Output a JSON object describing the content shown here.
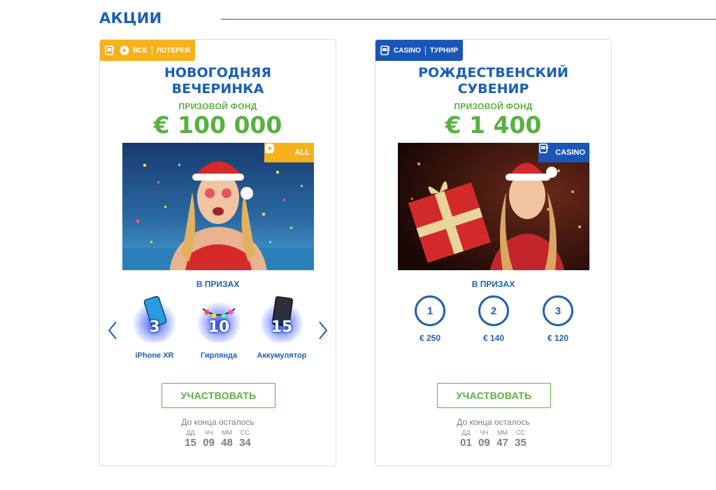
{
  "section": {
    "title": "АКЦИИ"
  },
  "promos": [
    {
      "tag": {
        "left": "ВСЕ",
        "right": "ЛОТЕРЕЯ"
      },
      "title": "НОВОГОДНЯЯ\nВЕЧЕРИНКА",
      "fund_label": "ПРИЗОВОЙ ФОНД",
      "fund_amount": "€ 100 000",
      "badge": "ALL",
      "prizes_label": "В ПРИЗАХ",
      "prizes": [
        {
          "qty": "3",
          "name": "iPhone XR",
          "icon": "phone-icon"
        },
        {
          "qty": "10",
          "name": "Гирлянда",
          "icon": "garland-icon"
        },
        {
          "qty": "15",
          "name": "Аккумулятор",
          "icon": "power-bank-icon"
        }
      ],
      "button": "УЧАСТВОВАТЬ",
      "remaining": "До конца осталось",
      "timer": {
        "labels": [
          "ДД",
          "ЧЧ",
          "ММ",
          "СС"
        ],
        "values": [
          "15",
          "09",
          "48",
          "34"
        ]
      }
    },
    {
      "tag": {
        "left": "CASINO",
        "right": "ТУРНИР"
      },
      "title": "РОЖДЕСТВЕНСКИЙ\nСУВЕНИР",
      "fund_label": "ПРИЗОВОЙ ФОНД",
      "fund_amount": "€ 1 400",
      "badge": "CASINO",
      "prizes_label": "В ПРИЗАХ",
      "places": [
        {
          "place": "1",
          "amount": "€ 250"
        },
        {
          "place": "2",
          "amount": "€ 140"
        },
        {
          "place": "3",
          "amount": "€ 120"
        }
      ],
      "button": "УЧАСТВОВАТЬ",
      "remaining": "До конца осталось",
      "timer": {
        "labels": [
          "ДД",
          "ЧЧ",
          "ММ",
          "СС"
        ],
        "values": [
          "01",
          "09",
          "47",
          "35"
        ]
      }
    }
  ],
  "colors": {
    "brand_blue": "#1b5fb3",
    "accent_green": "#58b042",
    "tag_orange": "#f6b21b",
    "tag_blue": "#1a56b8"
  }
}
